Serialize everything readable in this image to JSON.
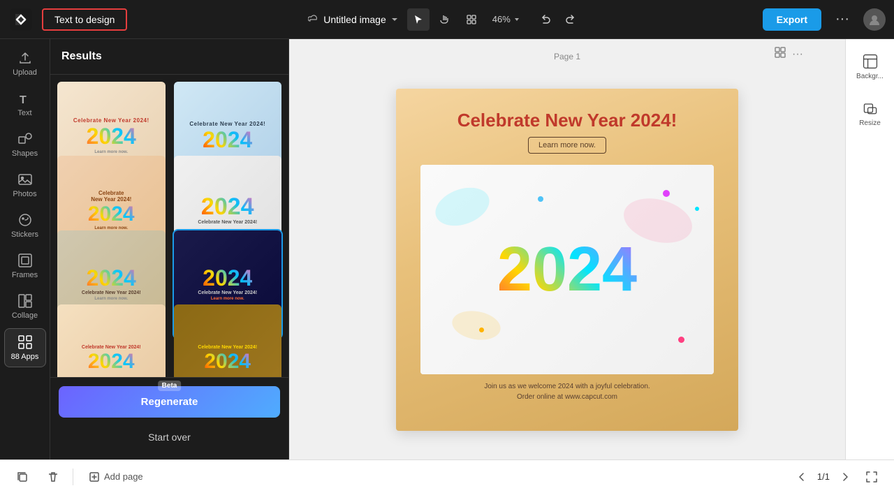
{
  "app": {
    "title": "CapCut",
    "text_to_design_label": "Text to design",
    "document_title": "Untitled image"
  },
  "topbar": {
    "zoom": "46%",
    "export_label": "Export",
    "more_label": "···"
  },
  "sidebar": {
    "items": [
      {
        "id": "upload",
        "label": "Upload",
        "icon": "upload"
      },
      {
        "id": "text",
        "label": "Text",
        "icon": "text"
      },
      {
        "id": "shapes",
        "label": "Shapes",
        "icon": "shapes"
      },
      {
        "id": "photos",
        "label": "Photos",
        "icon": "photos"
      },
      {
        "id": "stickers",
        "label": "Stickers",
        "icon": "stickers"
      },
      {
        "id": "frames",
        "label": "Frames",
        "icon": "frames"
      },
      {
        "id": "collage",
        "label": "Collage",
        "icon": "collage"
      },
      {
        "id": "apps",
        "label": "88 Apps",
        "icon": "apps",
        "active": true
      }
    ]
  },
  "panel": {
    "header": "Results",
    "templates": [
      {
        "id": 1,
        "title": "Celebrate New Year 2024!",
        "style": "card-1",
        "selected": false
      },
      {
        "id": 2,
        "title": "Celebrate New Year 2024!",
        "style": "card-2",
        "selected": false
      },
      {
        "id": 3,
        "title": "Celebrate New Year 2024!",
        "style": "card-3",
        "selected": false
      },
      {
        "id": 4,
        "title": "Celebrate New Year 2024!",
        "style": "card-4",
        "selected": false
      },
      {
        "id": 5,
        "title": "Celebrate New Year 2024!",
        "style": "card-5",
        "selected": false
      },
      {
        "id": 6,
        "title": "Celebrate New Year 2024!",
        "style": "card-6",
        "selected": true
      },
      {
        "id": 7,
        "title": "Celebrate New Year 2024!",
        "style": "card-7",
        "selected": false
      },
      {
        "id": 8,
        "title": "Celebrate New Year 2024!",
        "style": "card-8",
        "selected": false
      }
    ],
    "regenerate_label": "Regenerate",
    "beta_label": "Beta",
    "start_over_label": "Start over"
  },
  "canvas": {
    "page_label": "Page 1",
    "headline": "Celebrate New Year 2024!",
    "cta_button": "Learn more now.",
    "year_text": "2024",
    "footer_line1": "Join us as we welcome 2024 with a joyful celebration.",
    "footer_line2": "Order online at www.capcut.com"
  },
  "right_panel": {
    "items": [
      {
        "id": "background",
        "label": "Backgr..."
      },
      {
        "id": "resize",
        "label": "Resize"
      }
    ]
  },
  "bottombar": {
    "add_page_label": "Add page",
    "page_current": "1",
    "page_total": "1",
    "page_display": "1/1"
  }
}
